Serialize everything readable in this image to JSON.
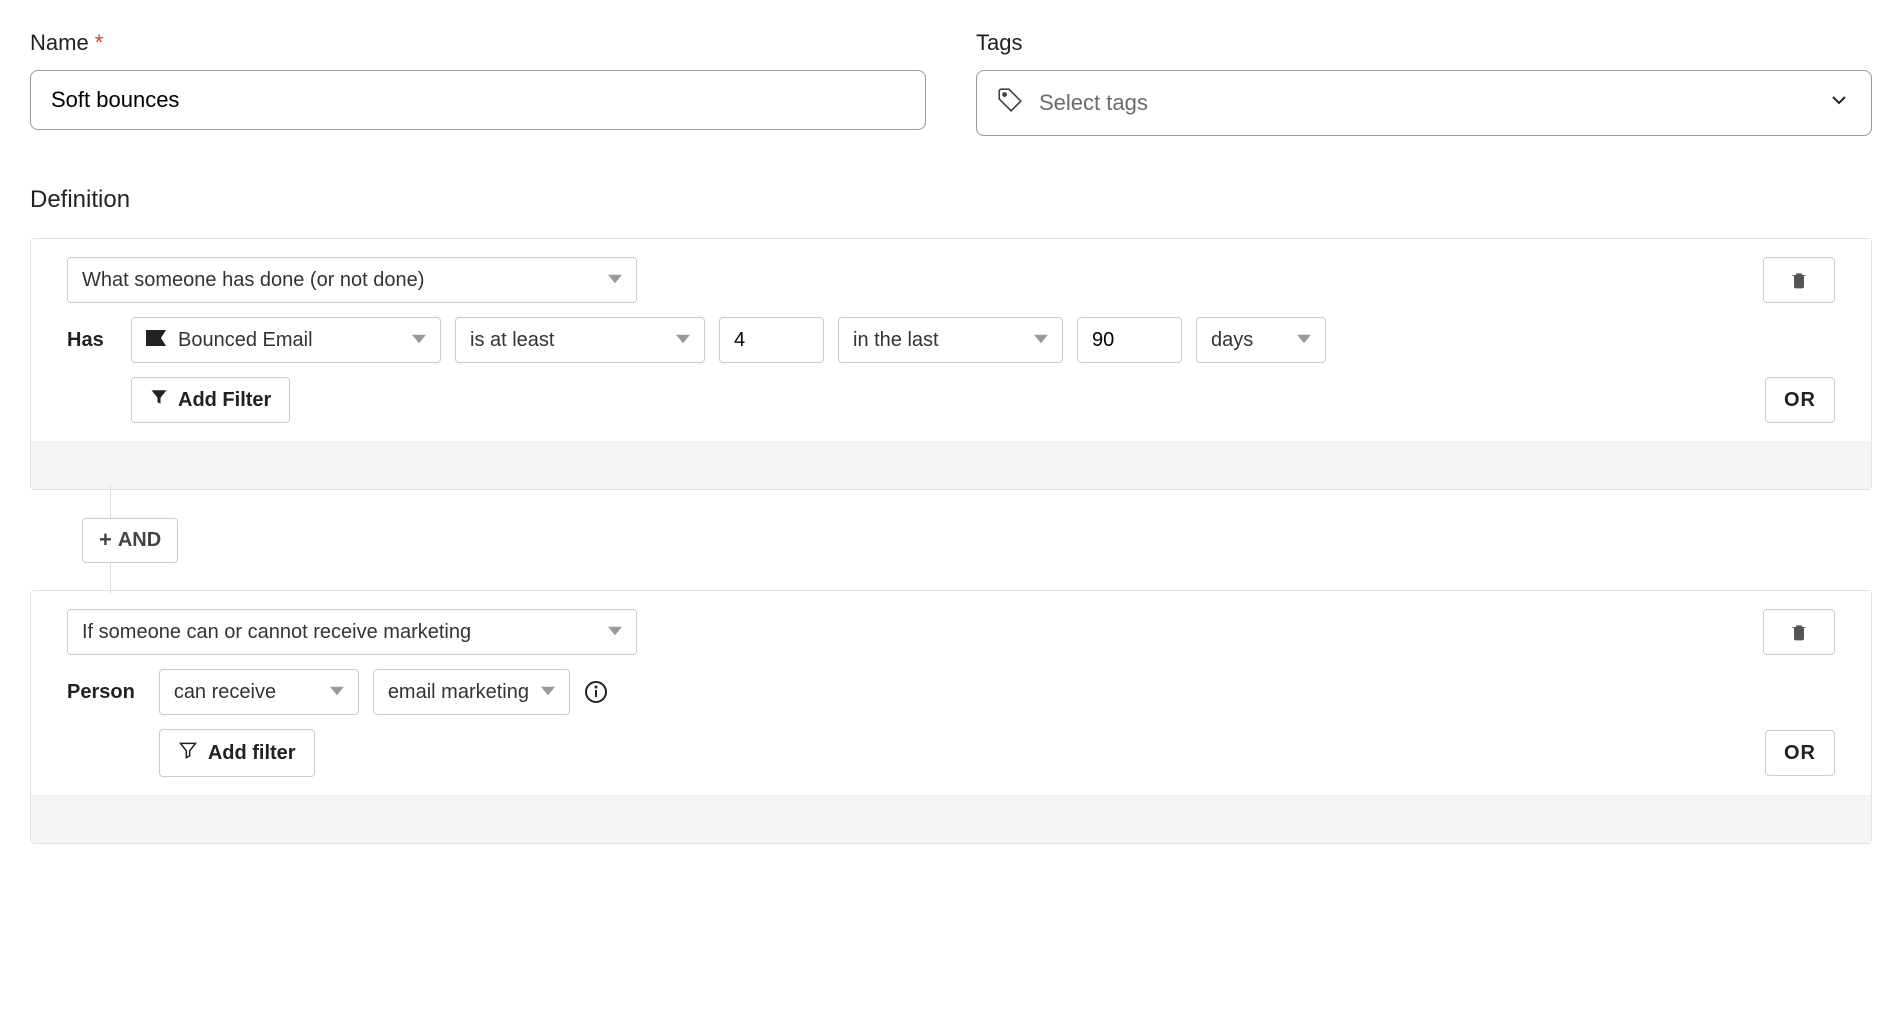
{
  "fields": {
    "name_label": "Name",
    "name_value": "Soft bounces",
    "tags_label": "Tags",
    "tags_placeholder": "Select tags"
  },
  "definition": {
    "title": "Definition",
    "and_label": "AND",
    "blocks": [
      {
        "type_label": "What someone has done (or not done)",
        "label": "Has",
        "action_label": "Bounced Email",
        "comparator_label": "is at least",
        "count_value": "4",
        "timeframe_label": "in the last",
        "duration_value": "90",
        "unit_label": "days",
        "add_filter_label": "Add Filter",
        "or_label": "OR"
      },
      {
        "type_label": "If someone can or cannot receive marketing",
        "label": "Person",
        "can_label": "can receive",
        "channel_label": "email marketing",
        "add_filter_label": "Add filter",
        "or_label": "OR"
      }
    ]
  }
}
